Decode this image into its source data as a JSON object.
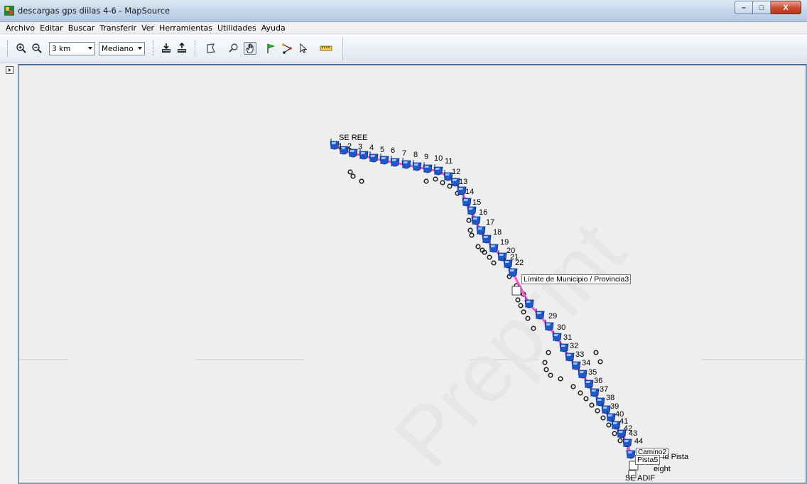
{
  "window": {
    "title": "descargas gps diilas 4-6 - MapSource",
    "buttons": {
      "minimize": "–",
      "maximize": "□",
      "close": "X"
    }
  },
  "menu": [
    "Archivo",
    "Editar",
    "Buscar",
    "Transferir",
    "Ver",
    "Herramientas",
    "Utilidades",
    "Ayuda"
  ],
  "toolbar": {
    "scale": "3 km",
    "detail": "Mediano",
    "icons": [
      "zoom-in-icon",
      "zoom-out-icon",
      "receive-from-device-icon",
      "send-to-device-icon",
      "map-tool-icon",
      "zoom-tool-icon",
      "hand-pan-tool-icon",
      "waypoint-flag-tool-icon",
      "route-tool-icon",
      "selection-arrow-icon",
      "measure-ruler-icon"
    ],
    "active_tool": "hand-pan-tool-icon"
  },
  "map": {
    "watermark": "Preprint",
    "route_colors": {
      "waypoint": "#1f58c8",
      "track": "#ff4fd0",
      "trail": "#222222"
    },
    "waypoints": [
      "SE REE",
      "1",
      "2",
      "3",
      "4",
      "5",
      "6",
      "7",
      "8",
      "9",
      "10",
      "11",
      "12",
      "13",
      "14",
      "15",
      "16",
      "17",
      "18",
      "19",
      "20",
      "21",
      "22",
      "29",
      "30",
      "31",
      "32",
      "33",
      "34",
      "35",
      "36",
      "37",
      "38",
      "39",
      "40",
      "41",
      "42",
      "43",
      "44",
      "SE ADIF"
    ],
    "labels": {
      "limite": "Límite de Municipio / Provincia3",
      "camino": "Camino2",
      "pista": "Pista5",
      "pista_full": "id Pista",
      "height": "eight"
    }
  }
}
